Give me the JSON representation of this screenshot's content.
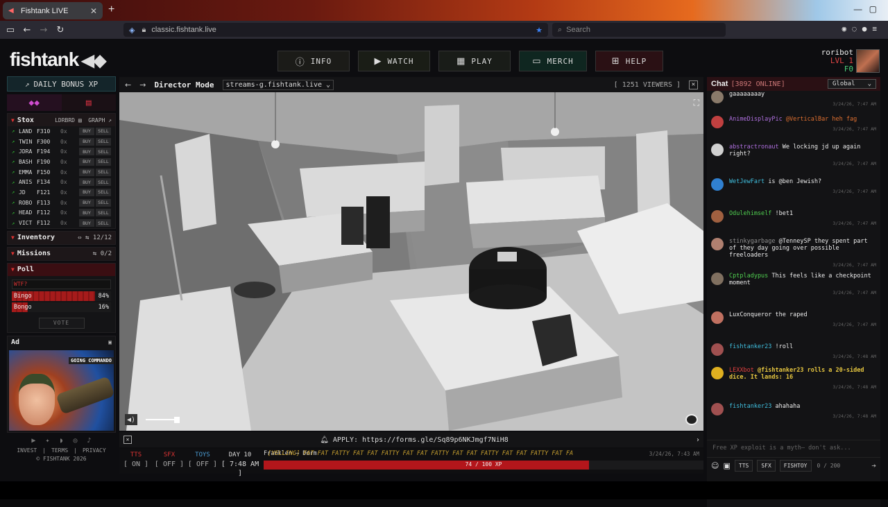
{
  "browser": {
    "tab_title": "Fishtank LIVE",
    "url": "classic.fishtank.live",
    "search_placeholder": "Search"
  },
  "header": {
    "logo": "fishtank",
    "nav": [
      {
        "label": "INFO",
        "icon": "info-icon"
      },
      {
        "label": "WATCH",
        "icon": "camera-icon"
      },
      {
        "label": "PLAY",
        "icon": "checker-icon"
      },
      {
        "label": "MERCH",
        "icon": "shop-icon"
      },
      {
        "label": "HELP",
        "icon": "help-icon"
      }
    ],
    "user": {
      "name": "roribot",
      "level": "LVL 1",
      "coins": "F0"
    }
  },
  "left": {
    "daily_bonus": "DAILY BONUS XP",
    "stox": {
      "title": "Stox",
      "ldrbrd": "LDRBRD",
      "graph": "GRAPH",
      "buy": "BUY",
      "sell": "SELL",
      "rows": [
        {
          "ticker": "LAND",
          "price": "F310",
          "qty": "0x"
        },
        {
          "ticker": "TWIN",
          "price": "F300",
          "qty": "0x"
        },
        {
          "ticker": "JDRA",
          "price": "F194",
          "qty": "0x"
        },
        {
          "ticker": "BASH",
          "price": "F190",
          "qty": "0x"
        },
        {
          "ticker": "EMMA",
          "price": "F150",
          "qty": "0x"
        },
        {
          "ticker": "ANIS",
          "price": "F134",
          "qty": "0x"
        },
        {
          "ticker": "JD",
          "price": "F121",
          "qty": "0x"
        },
        {
          "ticker": "ROBO",
          "price": "F113",
          "qty": "0x"
        },
        {
          "ticker": "HEAD",
          "price": "F112",
          "qty": "0x"
        },
        {
          "ticker": "VICT",
          "price": "F112",
          "qty": "0x"
        }
      ]
    },
    "inventory": {
      "title": "Inventory",
      "count": "12/12"
    },
    "missions": {
      "title": "Missions",
      "count": "0/2"
    },
    "poll": {
      "title": "Poll",
      "question": "WTF?",
      "options": [
        {
          "label": "Bingo",
          "pct_text": "84%",
          "pct": 84
        },
        {
          "label": "Bongo",
          "pct_text": "16%",
          "pct": 16
        }
      ],
      "vote": "VOTE"
    },
    "ad": {
      "title": "Ad",
      "caption": "GOING COMMANDO"
    },
    "footer": {
      "invest": "INVEST",
      "terms": "TERMS",
      "privacy": "PRIVACY",
      "copyright": "© FISHTANK 2026"
    }
  },
  "player": {
    "mode": "Director Mode",
    "stream": "streams-g.fishtank.live",
    "viewers": "[ 1251 VIEWERS ]",
    "volume": 0.72,
    "apply": "APPLY: https://forms.gle/Sq89p6NKJmgf7NiH8"
  },
  "status": {
    "tts": {
      "label": "TTS",
      "value": "[ ON ]"
    },
    "sfx": {
      "label": "SFX",
      "value": "[ OFF ]"
    },
    "toys": {
      "label": "TOYS",
      "value": "[ OFF ]"
    },
    "day": {
      "label": "DAY 10",
      "value": "[ 7:48 AM ]"
    },
    "ticker": {
      "who": "Franklen → Dorm",
      "msg": "[YELLING] FAT FAT FATTY FAT FAT FATTY FAT FAT FATTY FAT FAT FATTY FAT FAT FATTY FAT FA",
      "time": "3/24/26, 7:43 AM"
    },
    "xp": {
      "text": "74 / 100 XP",
      "value": 74,
      "max": 100
    }
  },
  "chat": {
    "title": "Chat",
    "online": "[3892 ONLINE]",
    "room": "Global",
    "messages": [
      {
        "user": "",
        "text": "gaaaaaaaay",
        "time": "3/24/26, 7:47 AM",
        "color": "#eeeeee",
        "avatar": "#8a7a6a"
      },
      {
        "user": "AnimeDisplayPic",
        "text": "@VerticalBar heh fag",
        "time": "3/24/26, 7:47 AM",
        "color": "#b070e0",
        "mention": true,
        "avatar": "#c04040"
      },
      {
        "user": "abstractronaut",
        "text": "We locking jd up again right?",
        "time": "3/24/26, 7:47 AM",
        "color": "#b070e0",
        "avatar": "#d0d0d0"
      },
      {
        "user": "WetJewFart",
        "text": "is @ben Jewish?",
        "time": "3/24/26, 7:47 AM",
        "color": "#40c0e0",
        "avatar": "#3080d0"
      },
      {
        "user": "Odulehimself",
        "text": "!bet1",
        "time": "3/24/26, 7:47 AM",
        "color": "#50d050",
        "avatar": "#a06040"
      },
      {
        "user": "stinkygarbage",
        "text": "@TenneySP they spent part of they day going over possible freeloaders",
        "time": "3/24/26, 7:47 AM",
        "color": "#909090",
        "avatar": "#b08070"
      },
      {
        "user": "Cptpladypus",
        "text": "This feels like a checkpoint moment",
        "time": "3/24/26, 7:47 AM",
        "color": "#50d050",
        "avatar": "#807060"
      },
      {
        "user": "LuxConqueror",
        "text": "the raped",
        "time": "3/24/26, 7:47 AM",
        "color": "#eeeeee",
        "avatar": "#c07060"
      },
      {
        "user": "fishtanker23",
        "text": "!roll",
        "time": "3/24/26, 7:48 AM",
        "color": "#40c0e0",
        "avatar": "#a05050"
      },
      {
        "user": "LEXXbot",
        "text": "@fishtanker23 rolls a 20-sided dice. It lands: 16",
        "time": "3/24/26, 7:48 AM",
        "color": "#e04040",
        "bot": true,
        "avatar": "#e0b020"
      },
      {
        "user": "fishtanker23",
        "text": "ahahaha",
        "time": "3/24/26, 7:48 AM",
        "color": "#40c0e0",
        "avatar": "#a05050"
      }
    ],
    "input_placeholder": "Free XP exploit is a myth— don't ask...",
    "tts": "TTS",
    "sfx": "SFX",
    "fishtoy": "FISHTOY",
    "char_count": "0 / 200"
  },
  "colors": {
    "accent_red": "#b3161b",
    "green": "#4ad07a",
    "bg": "#0d0d10"
  }
}
